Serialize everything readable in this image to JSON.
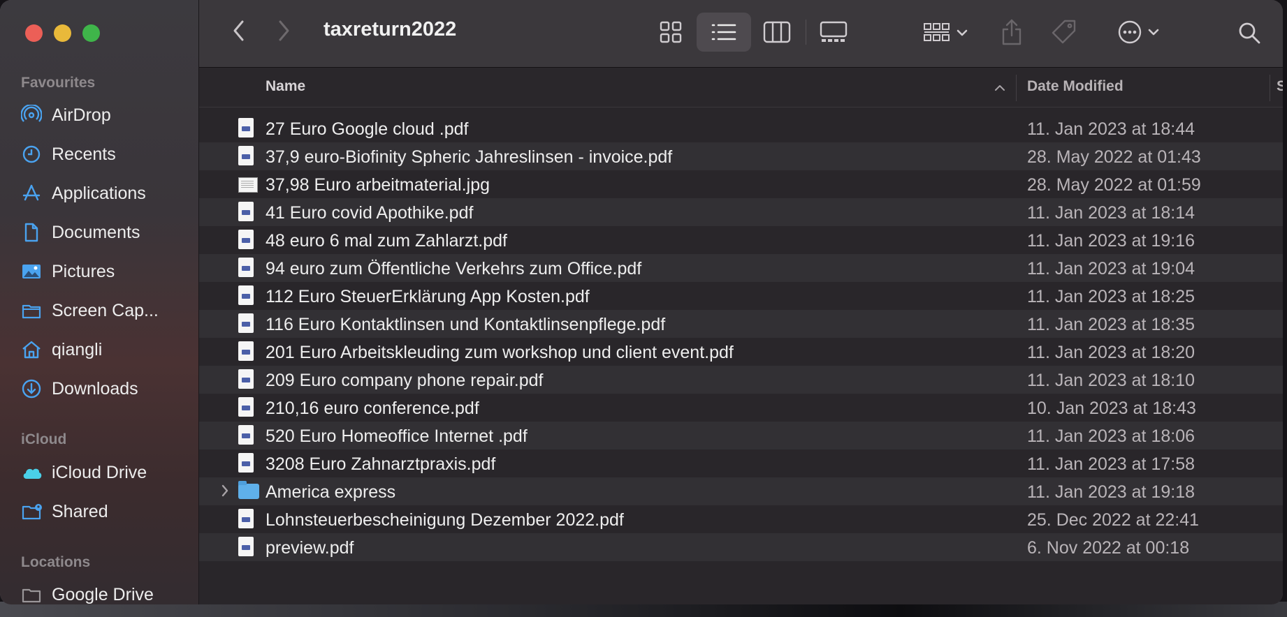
{
  "window": {
    "title": "taxreturn2022"
  },
  "sidebar": {
    "sections": [
      {
        "label": "Favourites"
      },
      {
        "label": "iCloud"
      },
      {
        "label": "Locations"
      }
    ],
    "favourites": [
      {
        "label": "AirDrop",
        "icon": "airdrop-icon"
      },
      {
        "label": "Recents",
        "icon": "clock-icon"
      },
      {
        "label": "Applications",
        "icon": "applications-icon"
      },
      {
        "label": "Documents",
        "icon": "document-icon"
      },
      {
        "label": "Pictures",
        "icon": "pictures-icon"
      },
      {
        "label": "Screen Cap...",
        "icon": "folder-icon"
      },
      {
        "label": "qiangli",
        "icon": "home-icon"
      },
      {
        "label": "Downloads",
        "icon": "download-icon"
      }
    ],
    "icloud": [
      {
        "label": "iCloud Drive",
        "icon": "cloud-icon"
      },
      {
        "label": "Shared",
        "icon": "shared-folder-icon"
      }
    ],
    "locations": [
      {
        "label": "Google Drive",
        "icon": "folder-icon"
      }
    ]
  },
  "columns": {
    "name": "Name",
    "date": "Date Modified",
    "size_partial": "S"
  },
  "files": [
    {
      "name": "27 Euro Google cloud .pdf",
      "date": "11. Jan 2023 at 18:44",
      "kind": "pdf"
    },
    {
      "name": "37,9 euro-Biofinity Spheric Jahreslinsen - invoice.pdf",
      "date": "28. May 2022 at 01:43",
      "kind": "pdf"
    },
    {
      "name": "37,98 Euro arbeitmaterial.jpg",
      "date": "28. May 2022 at 01:59",
      "kind": "image"
    },
    {
      "name": "41 Euro covid Apothike.pdf",
      "date": "11. Jan 2023 at 18:14",
      "kind": "pdf"
    },
    {
      "name": "48 euro 6 mal zum Zahlarzt.pdf",
      "date": "11. Jan 2023 at 19:16",
      "kind": "pdf"
    },
    {
      "name": "94 euro zum Öffentliche Verkehrs zum Office.pdf",
      "date": "11. Jan 2023 at 19:04",
      "kind": "pdf"
    },
    {
      "name": "112 Euro SteuerErklärung App Kosten.pdf",
      "date": "11. Jan 2023 at 18:25",
      "kind": "pdf"
    },
    {
      "name": "116 Euro Kontaktlinsen und Kontaktlinsenpflege.pdf",
      "date": "11. Jan 2023 at 18:35",
      "kind": "pdf"
    },
    {
      "name": "201 Euro Arbeitskleuding zum workshop und client event.pdf",
      "date": "11. Jan 2023 at 18:20",
      "kind": "pdf"
    },
    {
      "name": "209 Euro company phone repair.pdf",
      "date": "11. Jan 2023 at 18:10",
      "kind": "pdf"
    },
    {
      "name": "210,16 euro conference.pdf",
      "date": "10. Jan 2023 at 18:43",
      "kind": "pdf"
    },
    {
      "name": "520 Euro Homeoffice Internet .pdf",
      "date": "11. Jan 2023 at 18:06",
      "kind": "pdf"
    },
    {
      "name": "3208 Euro Zahnarztpraxis.pdf",
      "date": "11. Jan 2023 at 17:58",
      "kind": "pdf"
    },
    {
      "name": "America express",
      "date": "11. Jan 2023 at 19:18",
      "kind": "folder"
    },
    {
      "name": "Lohnsteuerbescheinigung Dezember 2022.pdf",
      "date": "25. Dec 2022 at 22:41",
      "kind": "pdf"
    },
    {
      "name": "preview.pdf",
      "date": "6. Nov 2022 at 00:18",
      "kind": "pdf"
    }
  ],
  "colors": {
    "accent": "#4aa3f0",
    "close": "#ec5f57",
    "minimize": "#e9b93a",
    "maximize": "#3fb54a"
  }
}
